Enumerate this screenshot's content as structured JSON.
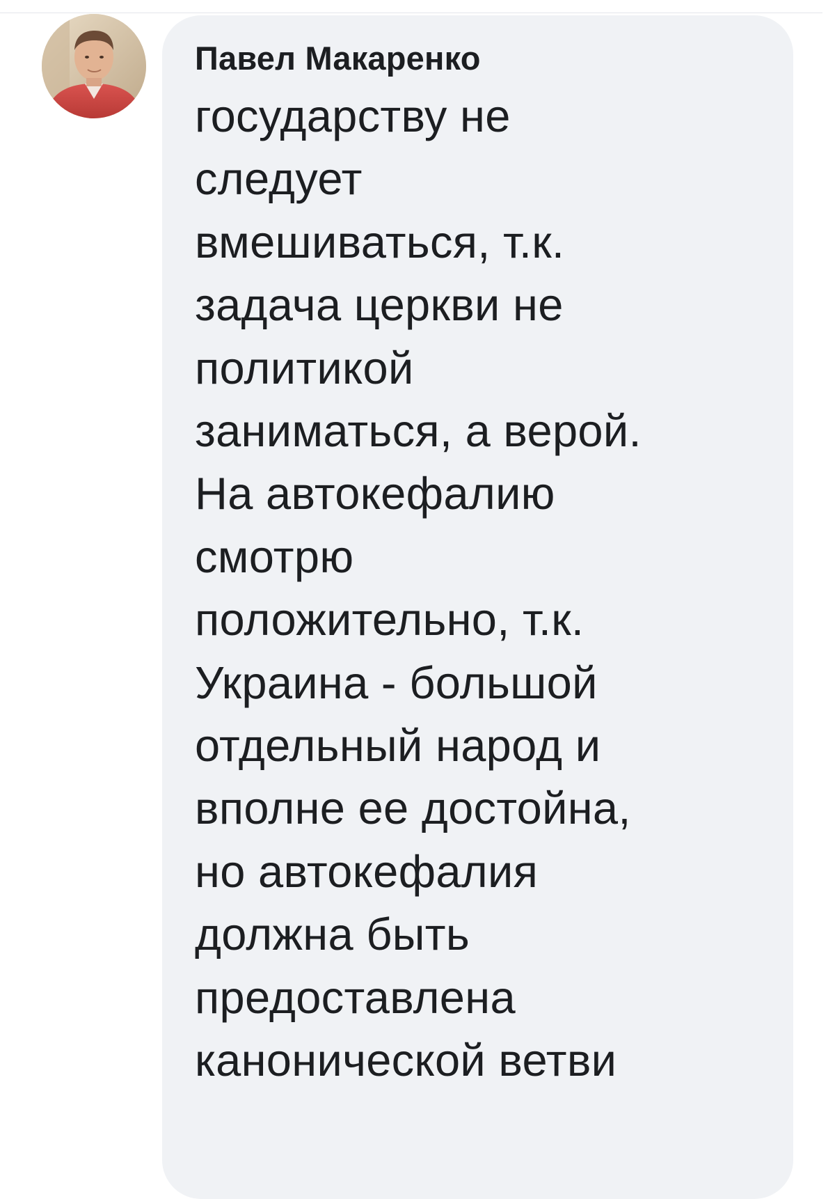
{
  "comment": {
    "author": "Павел Макаренко",
    "avatar_icon": "user-photo",
    "lines": [
      "государству не",
      "следует",
      "вмешиваться, т.к.",
      "задача церкви не",
      "политикой",
      "заниматься, а верой.",
      "На автокефалию",
      "смотрю",
      "положительно, т.к.",
      "Украина - большой",
      "отдельный народ и",
      "вполне ее достойна,",
      "но автокефалия",
      "должна быть",
      "предоставлена",
      "канонической ветви"
    ]
  },
  "colors": {
    "bubble_background": "#f0f2f5",
    "text": "#1c1e21",
    "page_background": "#ffffff"
  }
}
